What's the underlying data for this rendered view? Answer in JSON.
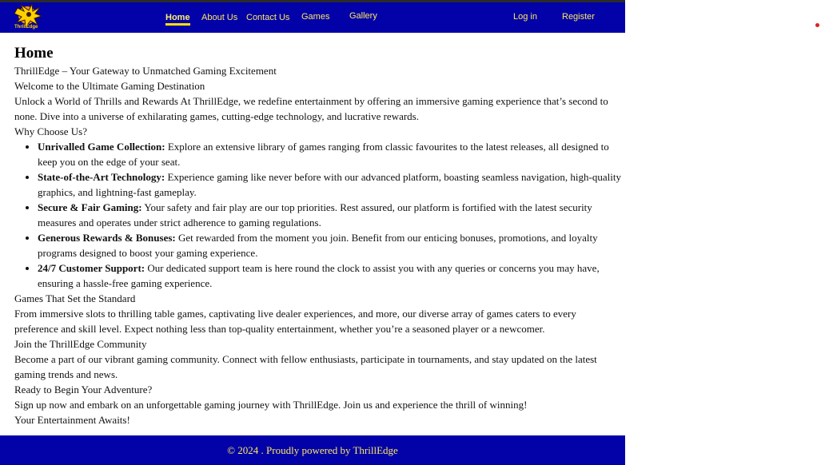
{
  "header": {
    "logo_text": "ThrillEdge",
    "nav": [
      "Home",
      "About Us",
      "Contact Us",
      "Games",
      "Gallery"
    ],
    "auth": [
      "Log in",
      "Register"
    ]
  },
  "main": {
    "title": "Home",
    "tagline": "ThrillEdge – Your Gateway to Unmatched Gaming Excitement",
    "welcome": "Welcome to the Ultimate Gaming Destination",
    "intro": "Unlock a World of Thrills and Rewards At ThrillEdge, we redefine entertainment by offering an immersive gaming experience that’s second to none. Dive into a universe of exhilarating games, cutting-edge technology, and lucrative rewards.",
    "why_heading": "Why Choose Us?",
    "features": [
      {
        "title": "Unrivalled Game Collection:",
        "text": " Explore an extensive library of games ranging from classic favourites to the latest releases, all designed to keep you on the edge of your seat."
      },
      {
        "title": "State-of-the-Art Technology:",
        "text": " Experience gaming like never before with our advanced platform, boasting seamless navigation, high-quality graphics, and lightning-fast gameplay."
      },
      {
        "title": "Secure & Fair Gaming:",
        "text": " Your safety and fair play are our top priorities. Rest assured, our platform is fortified with the latest security measures and operates under strict adherence to gaming regulations."
      },
      {
        "title": "Generous Rewards & Bonuses:",
        "text": " Get rewarded from the moment you join. Benefit from our enticing bonuses, promotions, and loyalty programs designed to boost your gaming experience."
      },
      {
        "title": "24/7 Customer Support:",
        "text": " Our dedicated support team is here round the clock to assist you with any queries or concerns you may have, ensuring a hassle-free gaming experience."
      }
    ],
    "games_heading": "Games That Set the Standard",
    "games_text": "From immersive slots to thrilling table games, captivating live dealer experiences, and more, our diverse array of games caters to every preference and skill level. Expect nothing less than top-quality entertainment, whether you’re a seasoned player or a newcomer.",
    "community_heading": "Join the ThrillEdge Community",
    "community_text": "Become a part of our vibrant gaming community. Connect with fellow enthusiasts, participate in tournaments, and stay updated on the latest gaming trends and news.",
    "ready_heading": "Ready to Begin Your Adventure?",
    "ready_text": "Sign up now and embark on an unforgettable gaming journey with ThrillEdge. Join us and experience the thrill of winning!",
    "closing": "Your Entertainment Awaits!"
  },
  "footer": {
    "text": "© 2024 . Proudly powered by ThrillEdge"
  },
  "colors": {
    "header_bg": "#0202a8",
    "nav_text": "#ffe860",
    "active_underline": "#ffe000"
  }
}
